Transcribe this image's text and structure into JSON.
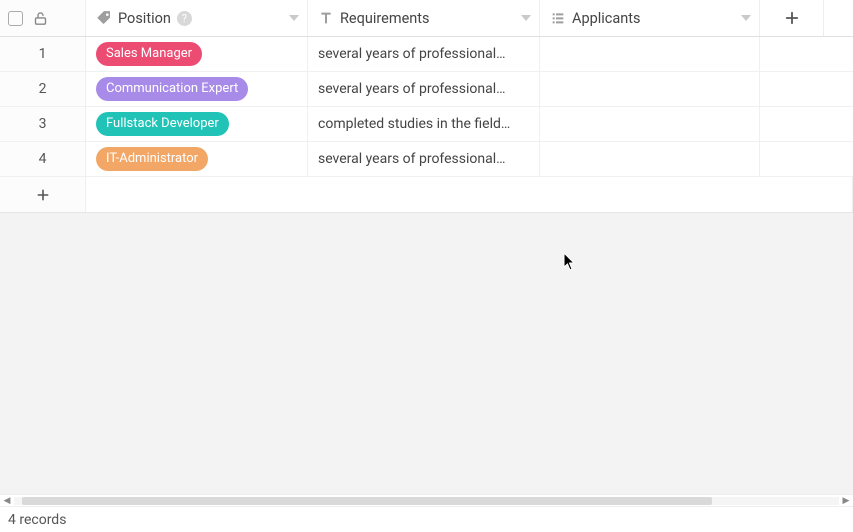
{
  "columns": {
    "position": {
      "label": "Position"
    },
    "requirements": {
      "label": "Requirements"
    },
    "applicants": {
      "label": "Applicants"
    }
  },
  "rows": [
    {
      "n": "1",
      "position": "Sales Manager",
      "pill_color": "#ec4b72",
      "req": "several years of professional…"
    },
    {
      "n": "2",
      "position": "Communication Expert",
      "pill_color": "#a88be8",
      "req": "several years of professional…"
    },
    {
      "n": "3",
      "position": "Fullstack Developer",
      "pill_color": "#20c3b6",
      "req": "completed studies in the field…"
    },
    {
      "n": "4",
      "position": "IT-Administrator",
      "pill_color": "#f2a766",
      "req": "several years of professional…"
    }
  ],
  "footer": {
    "records_label": "4 records"
  }
}
